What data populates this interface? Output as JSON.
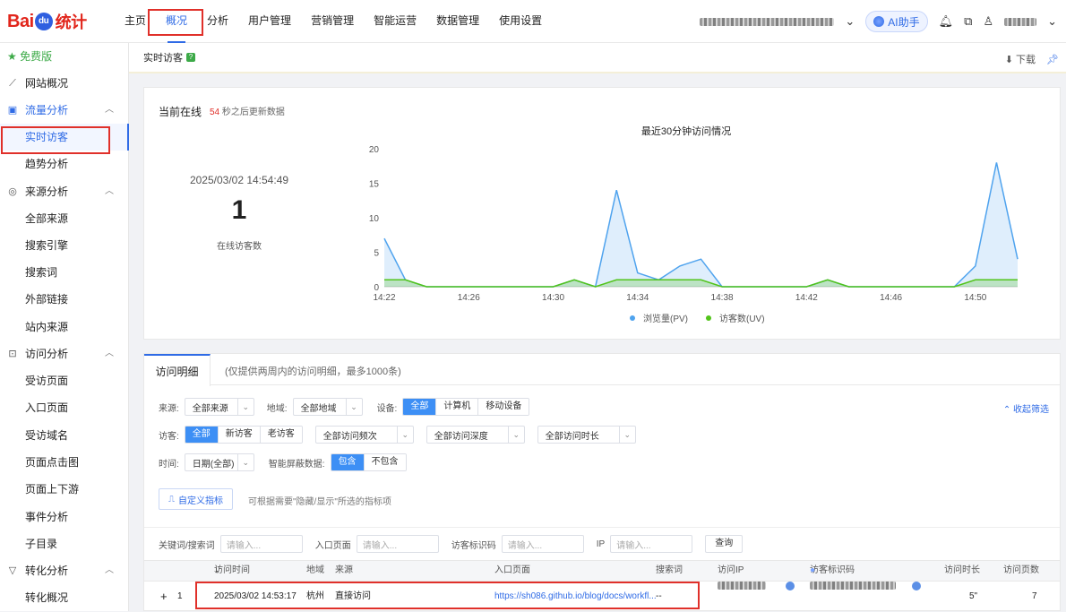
{
  "logo": {
    "text_a": "Bai",
    "text_du": "du",
    "text_b": "统计"
  },
  "nav": {
    "items": [
      "主页",
      "概况",
      "分析",
      "用户管理",
      "营销管理",
      "智能运营",
      "数据管理",
      "使用设置"
    ],
    "active_index": 1
  },
  "topbar": {
    "ai_label": "AI助手",
    "account_menu_icon": "chevron-down-icon"
  },
  "sidebar": {
    "free_label": "免费版",
    "groups": [
      {
        "label": "网站概况",
        "icon": "line-chart-icon",
        "items": []
      },
      {
        "label": "流量分析",
        "icon": "traffic-icon",
        "items": [
          "实时访客",
          "趋势分析"
        ]
      },
      {
        "label": "来源分析",
        "icon": "source-icon",
        "items": [
          "全部来源",
          "搜索引擎",
          "搜索词",
          "外部链接",
          "站内来源"
        ]
      },
      {
        "label": "访问分析",
        "icon": "visit-icon",
        "items": [
          "受访页面",
          "入口页面",
          "受访域名",
          "页面点击图",
          "页面上下游",
          "事件分析",
          "子目录"
        ]
      },
      {
        "label": "转化分析",
        "icon": "funnel-icon",
        "items": [
          "转化概况"
        ]
      }
    ],
    "active_item": "实时访客"
  },
  "crumb": {
    "title": "实时访客",
    "download": "下载"
  },
  "online": {
    "label": "当前在线",
    "countdown_num": "54",
    "countdown_text": "秒之后更新数据",
    "time": "2025/03/02 14:54:49",
    "count": "1",
    "count_label": "在线访客数"
  },
  "chart_data": {
    "type": "area",
    "title": "最近30分钟访问情况",
    "x": [
      "14:22",
      "14:23",
      "14:24",
      "14:25",
      "14:26",
      "14:27",
      "14:28",
      "14:29",
      "14:30",
      "14:31",
      "14:32",
      "14:33",
      "14:34",
      "14:35",
      "14:36",
      "14:37",
      "14:38",
      "14:39",
      "14:40",
      "14:41",
      "14:42",
      "14:43",
      "14:44",
      "14:45",
      "14:46",
      "14:47",
      "14:48",
      "14:49",
      "14:50",
      "14:51",
      "14:52"
    ],
    "xticks": [
      "14:22",
      "14:26",
      "14:30",
      "14:34",
      "14:38",
      "14:42",
      "14:46",
      "14:50"
    ],
    "ylim": [
      0,
      20
    ],
    "yticks": [
      0,
      5,
      10,
      15,
      20
    ],
    "series": [
      {
        "name": "浏览量(PV)",
        "color": "#4fa3ee",
        "values": [
          7,
          1,
          0,
          0,
          0,
          0,
          0,
          0,
          0,
          1,
          0,
          14,
          2,
          1,
          3,
          4,
          0,
          0,
          0,
          0,
          0,
          1,
          0,
          0,
          0,
          0,
          0,
          0,
          3,
          18,
          4
        ]
      },
      {
        "name": "访客数(UV)",
        "color": "#52c41a",
        "values": [
          1,
          1,
          0,
          0,
          0,
          0,
          0,
          0,
          0,
          1,
          0,
          1,
          1,
          1,
          1,
          1,
          0,
          0,
          0,
          0,
          0,
          1,
          0,
          0,
          0,
          0,
          0,
          0,
          1,
          1,
          1
        ]
      }
    ],
    "legend": "bottom",
    "grid": false
  },
  "detail": {
    "tab": "访问明细",
    "note": "(仅提供两周内的访问明细，最多1000条)",
    "collapse": "收起筛选",
    "filters": {
      "source_label": "来源:",
      "source_value": "全部来源",
      "region_label": "地域:",
      "region_value": "全部地域",
      "device_label": "设备:",
      "device_options": [
        "全部",
        "计算机",
        "移动设备"
      ],
      "visitor_label": "访客:",
      "visitor_options": [
        "全部",
        "新访客",
        "老访客"
      ],
      "freq_value": "全部访问频次",
      "depth_value": "全部访问深度",
      "duration_value": "全部访问时长",
      "time_label": "时间:",
      "time_value": "日期(全部)",
      "smart_label": "智能屏蔽数据:",
      "smart_options": [
        "包含",
        "不包含"
      ]
    },
    "custom_btn": "自定义指标",
    "custom_note": "可根据需要\"隐藏/显示\"所选的指标项",
    "search": {
      "kw_label": "关键词/搜索词",
      "entry_label": "入口页面",
      "code_label": "访客标识码",
      "ip_label": "IP",
      "placeholder": "请输入...",
      "query": "查询"
    },
    "columns": [
      "访问时间",
      "地域",
      "来源",
      "入口页面",
      "搜索词",
      "访问IP",
      "访客标识码",
      "访问时长",
      "访问页数"
    ],
    "rows": [
      {
        "index": "1",
        "expand": "+",
        "time": "2025/03/02 14:53:17",
        "region": "杭州",
        "source": "直接访问",
        "entry": "https://sh086.github.io/blog/docs/workfl...",
        "keyword": "--",
        "duration": "5\"",
        "pages": "7"
      }
    ]
  }
}
